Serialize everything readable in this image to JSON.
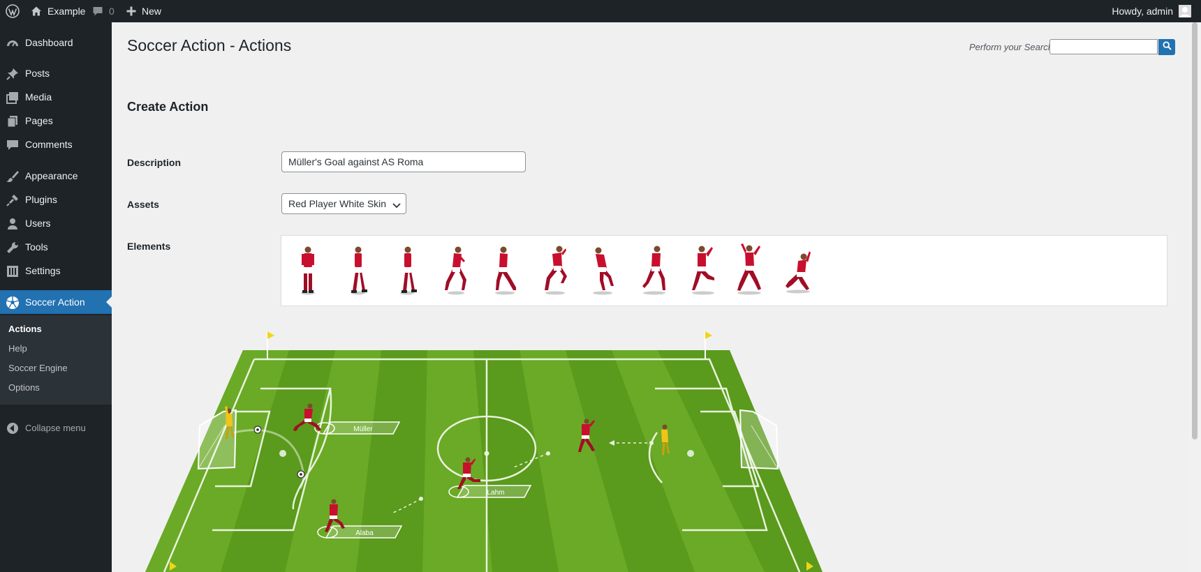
{
  "adminbar": {
    "site_name": "Example",
    "comment_count": "0",
    "new_label": "New",
    "greeting": "Howdy, admin"
  },
  "menu": {
    "items": [
      {
        "label": "Dashboard",
        "icon": "dashboard-icon"
      },
      {
        "label": "Posts",
        "icon": "pin-icon"
      },
      {
        "label": "Media",
        "icon": "media-icon"
      },
      {
        "label": "Pages",
        "icon": "pages-icon"
      },
      {
        "label": "Comments",
        "icon": "comments-icon"
      },
      {
        "label": "Appearance",
        "icon": "brush-icon"
      },
      {
        "label": "Plugins",
        "icon": "plug-icon"
      },
      {
        "label": "Users",
        "icon": "user-icon"
      },
      {
        "label": "Tools",
        "icon": "wrench-icon"
      },
      {
        "label": "Settings",
        "icon": "settings-icon"
      },
      {
        "label": "Soccer Action",
        "icon": "soccer-ball-icon"
      }
    ],
    "submenu": [
      "Actions",
      "Help",
      "Soccer Engine",
      "Options"
    ],
    "collapse_label": "Collapse menu"
  },
  "page": {
    "title": "Soccer Action - Actions",
    "search_label": "Perform your Search",
    "section_title": "Create Action"
  },
  "form": {
    "description_label": "Description",
    "description_value": "Müller's Goal against AS Roma",
    "assets_label": "Assets",
    "assets_value": "Red Player White Skin",
    "elements_label": "Elements"
  },
  "elements": {
    "count": 11,
    "poses": [
      "standing",
      "walking",
      "walking",
      "running",
      "running",
      "running",
      "running",
      "kicking",
      "kicking",
      "shooting",
      "sliding"
    ]
  },
  "field": {
    "player_tags": [
      "Müller",
      "Lahm",
      "Alaba"
    ]
  },
  "colors": {
    "admin_dark": "#1d2327",
    "accent_blue": "#2271b1",
    "background": "#f0f0f1",
    "kit_red": "#c8102e",
    "goalkeeper_yellow": "#f2c31a",
    "grass_green": "#5a9a1c"
  }
}
